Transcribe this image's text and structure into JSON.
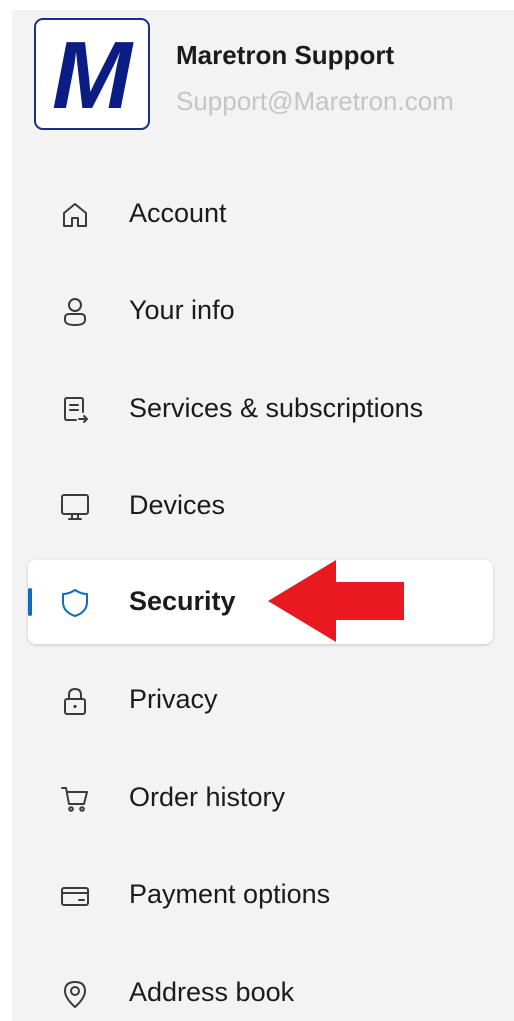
{
  "profile": {
    "avatar_letter": "M",
    "name": "Maretron Support",
    "email": "Support@Maretron.com"
  },
  "nav": {
    "items": [
      {
        "label": "Account",
        "icon": "home-icon"
      },
      {
        "label": "Your info",
        "icon": "person-icon"
      },
      {
        "label": "Services & subscriptions",
        "icon": "subscriptions-icon"
      },
      {
        "label": "Devices",
        "icon": "monitor-icon"
      },
      {
        "label": "Security",
        "icon": "shield-icon",
        "selected": true
      },
      {
        "label": "Privacy",
        "icon": "lock-icon"
      },
      {
        "label": "Order history",
        "icon": "cart-icon"
      },
      {
        "label": "Payment options",
        "icon": "credit-card-icon"
      },
      {
        "label": "Address book",
        "icon": "location-pin-icon"
      }
    ]
  },
  "colors": {
    "panel_background": "#f3f3f3",
    "accent": "#0f6cbd",
    "logo_blue": "#0b1d84",
    "arrow_red": "#e8191f",
    "email_gray": "#c5c5c5"
  }
}
